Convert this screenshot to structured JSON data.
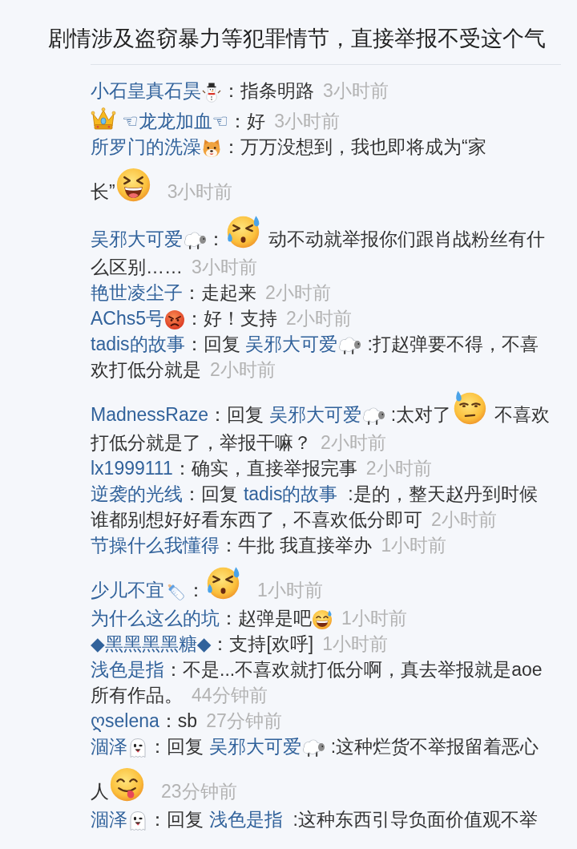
{
  "post": {
    "title": "剧情涉及盗窃暴力等犯罪情节，直接举报不受这个气"
  },
  "comments": [
    {
      "parts": [
        {
          "kind": "user",
          "text": "小石皇真石昊"
        },
        {
          "kind": "emoji"
        },
        {
          "kind": "text",
          "text": "：指条明路"
        }
      ],
      "time": "3小时前"
    },
    {
      "parts": [
        {
          "kind": "emoji"
        },
        {
          "kind": "user",
          "text": "☜龙龙加血☜"
        },
        {
          "kind": "text",
          "text": "：好"
        }
      ],
      "time": "3小时前"
    },
    {
      "parts": [
        {
          "kind": "user",
          "text": "所罗门的洗澡"
        },
        {
          "kind": "emoji"
        },
        {
          "kind": "text",
          "text": "：万万没想到，我也即将成为“家长”"
        },
        {
          "kind": "sticker"
        }
      ],
      "time": "3小时前"
    },
    {
      "parts": [
        {
          "kind": "user",
          "text": "吴邪大可爱"
        },
        {
          "kind": "emoji"
        },
        {
          "kind": "text",
          "text": "："
        },
        {
          "kind": "sticker"
        },
        {
          "kind": "text",
          "text": "动不动就举报你们跟肖战粉丝有什么区别……"
        }
      ],
      "time": "3小时前"
    },
    {
      "parts": [
        {
          "kind": "user",
          "text": "艳世凌尘子"
        },
        {
          "kind": "text",
          "text": "：走起来"
        }
      ],
      "time": "2小时前"
    },
    {
      "parts": [
        {
          "kind": "user",
          "text": "AChs5号"
        },
        {
          "kind": "emoji"
        },
        {
          "kind": "text",
          "text": "：好！支持"
        }
      ],
      "time": "2小时前"
    },
    {
      "parts": [
        {
          "kind": "user",
          "text": "tadis的故事"
        },
        {
          "kind": "text",
          "text": "：回复"
        },
        {
          "kind": "user",
          "text": "吴邪大可爱"
        },
        {
          "kind": "emoji"
        },
        {
          "kind": "text",
          "text": ":打赵弹要不得，不喜欢打低分就是"
        }
      ],
      "time": "2小时前"
    },
    {
      "parts": [
        {
          "kind": "user",
          "text": "MadnessRaze"
        },
        {
          "kind": "text",
          "text": "：回复"
        },
        {
          "kind": "user",
          "text": "吴邪大可爱"
        },
        {
          "kind": "emoji"
        },
        {
          "kind": "text",
          "text": ":太对了"
        },
        {
          "kind": "sticker"
        },
        {
          "kind": "text",
          "text": "不喜欢打低分就是了，举报干嘛？"
        }
      ],
      "time": "2小时前"
    },
    {
      "parts": [
        {
          "kind": "user",
          "text": "lx1999111"
        },
        {
          "kind": "text",
          "text": "：确实，直接举报完事"
        }
      ],
      "time": "2小时前"
    },
    {
      "parts": [
        {
          "kind": "user",
          "text": "逆袭的光线"
        },
        {
          "kind": "text",
          "text": "：回复"
        },
        {
          "kind": "user",
          "text": "tadis的故事"
        },
        {
          "kind": "text",
          "text": ":是的，整天赵丹到时候谁都别想好好看东西了，不喜欢低分即可"
        }
      ],
      "time": "2小时前"
    },
    {
      "parts": [
        {
          "kind": "user",
          "text": "节操什么我懂得"
        },
        {
          "kind": "text",
          "text": "：牛批 我直接举办"
        }
      ],
      "time": "1小时前"
    },
    {
      "parts": [
        {
          "kind": "user",
          "text": "少儿不宜"
        },
        {
          "kind": "emoji"
        },
        {
          "kind": "text",
          "text": "："
        },
        {
          "kind": "sticker"
        }
      ],
      "time": "1小时前"
    },
    {
      "parts": [
        {
          "kind": "user",
          "text": "为什么这么的坑"
        },
        {
          "kind": "text",
          "text": "：赵弹是吧"
        },
        {
          "kind": "emoji"
        }
      ],
      "time": "1小时前"
    },
    {
      "parts": [
        {
          "kind": "user",
          "text": "◆黑黑黑黑糖◆"
        },
        {
          "kind": "text",
          "text": "：支持[欢呼]"
        }
      ],
      "time": "1小时前"
    },
    {
      "parts": [
        {
          "kind": "user",
          "text": "浅色是指"
        },
        {
          "kind": "text",
          "text": "：不是...不喜欢就打低分啊，真去举报就是aoe所有作品。"
        }
      ],
      "time": "44分钟前"
    },
    {
      "parts": [
        {
          "kind": "user",
          "text": "ღselena"
        },
        {
          "kind": "text",
          "text": "：sb"
        }
      ],
      "time": "27分钟前"
    },
    {
      "parts": [
        {
          "kind": "user",
          "text": "涸泽"
        },
        {
          "kind": "emoji"
        },
        {
          "kind": "text",
          "text": "：回复"
        },
        {
          "kind": "user",
          "text": "吴邪大可爱"
        },
        {
          "kind": "emoji"
        },
        {
          "kind": "text",
          "text": ":这种烂货不举报留着恶心人"
        },
        {
          "kind": "sticker"
        }
      ],
      "time": "23分钟前"
    },
    {
      "parts": [
        {
          "kind": "user",
          "text": "涸泽"
        },
        {
          "kind": "emoji"
        },
        {
          "kind": "text",
          "text": "：回复"
        },
        {
          "kind": "user",
          "text": "浅色是指"
        },
        {
          "kind": "text",
          "text": ":这种东西引导负面价值观不举"
        }
      ]
    }
  ]
}
